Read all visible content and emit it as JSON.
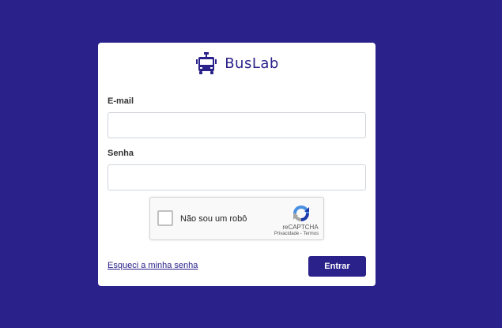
{
  "brand": {
    "name": "BusLab",
    "icon": "bus-icon",
    "color": "#2a228a"
  },
  "background_color": "#2a228a",
  "form": {
    "email": {
      "label": "E-mail",
      "value": "",
      "placeholder": ""
    },
    "password": {
      "label": "Senha",
      "value": "",
      "placeholder": ""
    },
    "captcha": {
      "label": "Não sou um robô",
      "brand": "reCAPTCHA",
      "links": "Privacidade - Termos",
      "checked": false
    },
    "forgot_password": "Esqueci a minha senha",
    "submit": "Entrar"
  }
}
